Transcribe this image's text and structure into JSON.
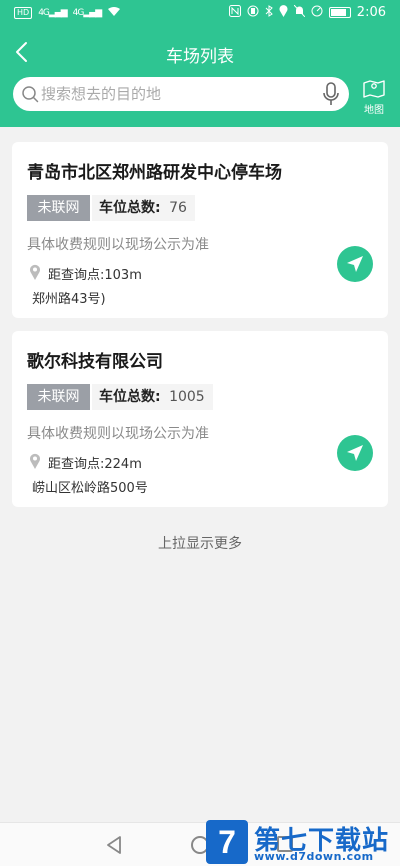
{
  "status_bar": {
    "left_badge": "HD",
    "signal1": "4G",
    "signal2": "4G",
    "time": "2:06"
  },
  "header": {
    "title": "车场列表"
  },
  "search": {
    "placeholder": "搜索想去的目的地",
    "map_label": "地图"
  },
  "parking_lots": [
    {
      "name": "青岛市北区郑州路研发中心停车场",
      "status_tag": "未联网",
      "spaces_label": "车位总数:",
      "spaces_value": "76",
      "rule": "具体收费规则以现场公示为准",
      "distance": "距查询点:103m",
      "address": "郑州路43号)"
    },
    {
      "name": "歌尔科技有限公司",
      "status_tag": "未联网",
      "spaces_label": "车位总数:",
      "spaces_value": "1005",
      "rule": "具体收费规则以现场公示为准",
      "distance": "距查询点:224m",
      "address": "崂山区松岭路500号"
    }
  ],
  "load_more": "上拉显示更多",
  "watermark": {
    "logo_char": "7",
    "text": "第七下载站",
    "url": "www.d7down.com"
  },
  "colors": {
    "accent": "#2ec592",
    "tag_gray": "#9b9fa6",
    "watermark_blue": "#1769c9"
  }
}
